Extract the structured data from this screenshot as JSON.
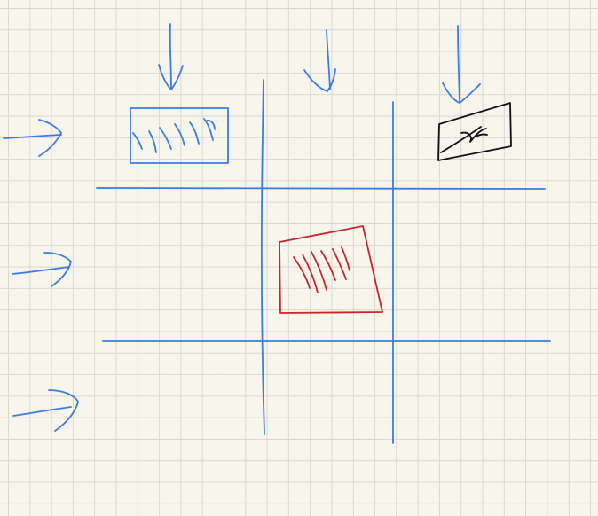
{
  "page": {
    "background": "#f7f5ec",
    "grid_color": "#d9d8d0"
  },
  "ink": {
    "blue": "#3a7de0",
    "red": "#c8262a",
    "black": "#111111"
  },
  "cells": {
    "top_left": {
      "shape": "rectangle",
      "fill": "hatched",
      "color": "blue"
    },
    "top_right": {
      "shape": "parallelogram",
      "fill": "scribble",
      "color": "black"
    },
    "middle_center": {
      "shape": "quadrilateral",
      "fill": "hatched",
      "color": "red"
    }
  }
}
